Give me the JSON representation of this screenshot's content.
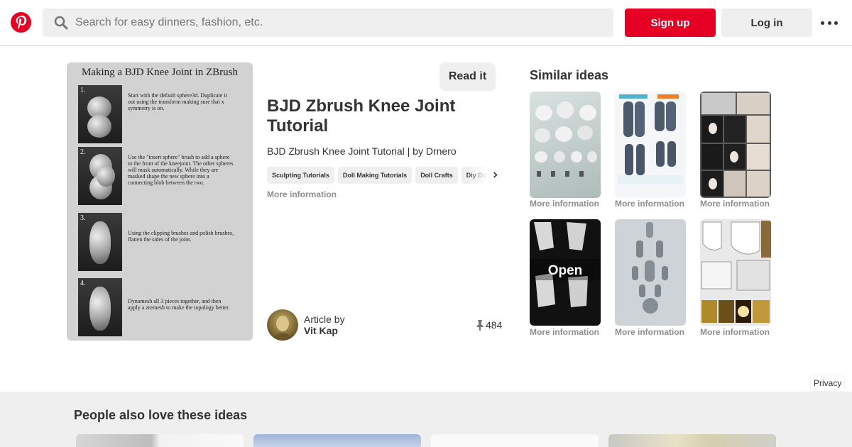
{
  "header": {
    "logo_icon": "pinterest-logo-icon",
    "search_icon": "search-icon",
    "search_placeholder": "Search for easy dinners, fashion, etc.",
    "signup_label": "Sign up",
    "login_label": "Log in",
    "more_icon": "more-dots-icon"
  },
  "pin": {
    "image": {
      "title": "Making a BJD Knee Joint in ZBrush",
      "steps": [
        {
          "num": "1.",
          "text": "Start with the default sphere3d. Duplicate it out using the transform making sure that x symmetry is on."
        },
        {
          "num": "2.",
          "text": "Use the \"insert sphere\" brush to add a sphere to the front of the kneejoint. The other spheres will mask automatically. While they are masked shape the new sphere into a connecting blob between the two."
        },
        {
          "num": "3.",
          "text": "Using the clipping brushes and polish brushes, flatten the sides of the joint."
        },
        {
          "num": "4.",
          "text": "Dynamesh all 3 pieces together, and then apply a zremesh to make the topology better."
        }
      ]
    },
    "read_it_label": "Read it",
    "title": "BJD Zbrush Knee Joint Tutorial",
    "description": "BJD Zbrush Knee Joint Tutorial | by Drnero",
    "tags": [
      "Sculpting Tutorials",
      "Doll Making Tutorials",
      "Doll Crafts",
      "Diy Doll"
    ],
    "more_info_label": "More information",
    "article_by_label": "Article by",
    "author_name": "Vit Kap",
    "saves_icon": "pushpin-icon",
    "saves_count": "484"
  },
  "similar": {
    "title": "Similar ideas",
    "items": [
      {
        "label": "More information"
      },
      {
        "label": "More information"
      },
      {
        "label": "More information"
      },
      {
        "label": "More information",
        "overlay": "Open"
      },
      {
        "label": "More information"
      },
      {
        "label": "More information"
      }
    ]
  },
  "privacy_label": "Privacy",
  "also": {
    "title": "People also love these ideas"
  },
  "colors": {
    "brand": "#e60023",
    "button_gray": "#efefef",
    "muted_text": "#8e8e8e"
  }
}
